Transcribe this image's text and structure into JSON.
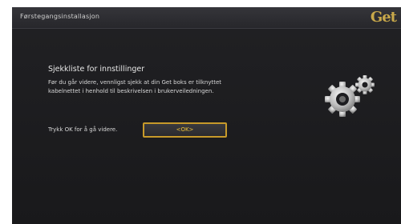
{
  "window": {
    "title": "Førstegangsinstallasjon",
    "logo_text": "Get"
  },
  "main": {
    "heading": "Sjekkliste for innstillinger",
    "description_lines": [
      "Før du går videre, vennligst sjekk at din Get boks er tilknyttet",
      "kabelnettet i henhold til beskrivelsen i brukerveiledningen."
    ],
    "prompt": "Trykk OK for å gå videre.",
    "ok_label": "<OK>"
  },
  "icons": {
    "gears": "gears-icon"
  },
  "colors": {
    "accent": "#c79a2a",
    "button_text": "#f0c43c",
    "logo": "#c8a84a",
    "background": "#1b1b1d"
  }
}
